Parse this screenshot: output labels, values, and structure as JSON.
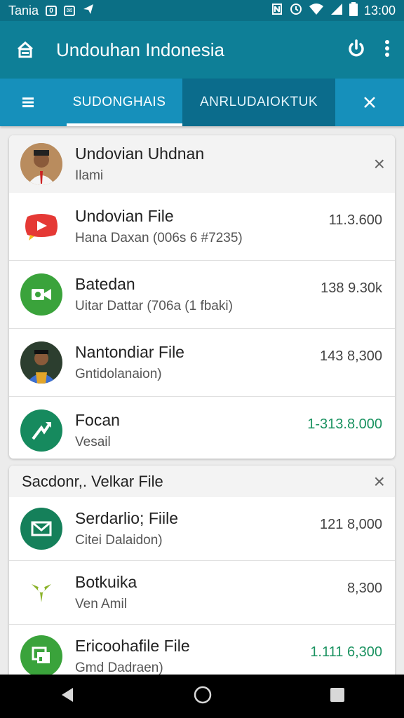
{
  "status_bar": {
    "carrier": "Tania",
    "time": "13:00"
  },
  "app_bar": {
    "title": "Undouhan Indonesia"
  },
  "tabs": [
    {
      "label": "SUDONGHAIS"
    },
    {
      "label": "ANRLUDAIOKTUK"
    }
  ],
  "colors": {
    "appbar": "#0e7f97",
    "tabs": "#1690bb",
    "active_tab_bg": "#0b6c8c",
    "green_size": "#1a9260"
  },
  "card1": {
    "header": {
      "title": "Undovian Uhdnan",
      "subtitle": "Ilami"
    },
    "items": [
      {
        "name": "Undovian File",
        "sub": "Hana Daxan (006s 6 #7235)",
        "size": "11.3.600",
        "icon": "youtube-icon"
      },
      {
        "name": "Batedan",
        "sub": "Uitar Dattar (706a (1 fbaki)",
        "size": "138 9.30k",
        "icon": "video-call-icon"
      },
      {
        "name": "Nantondiar File",
        "sub": "Gntidolanaion)",
        "size": "143 8,300",
        "icon": "user-avatar"
      },
      {
        "name": "Focan",
        "sub": "Vesail",
        "size": "1-313.8.000",
        "icon": "chart-arrow-icon",
        "size_green": true
      }
    ]
  },
  "card2": {
    "header": {
      "title": "Sacdonr,. Velkar File"
    },
    "items": [
      {
        "name": "Serdarlio; Fiile",
        "sub": "Citei Dalaidon)",
        "size": "121 8,000",
        "icon": "mail-icon"
      },
      {
        "name": "Botkuika",
        "sub": "Ven Amil",
        "size": "8,300",
        "icon": "leaf-icon"
      },
      {
        "name": "Ericoohafile File",
        "sub": "Gmd Dadraen)",
        "size": "1.111 6,300",
        "icon": "gallery-icon",
        "size_green": true
      }
    ]
  }
}
